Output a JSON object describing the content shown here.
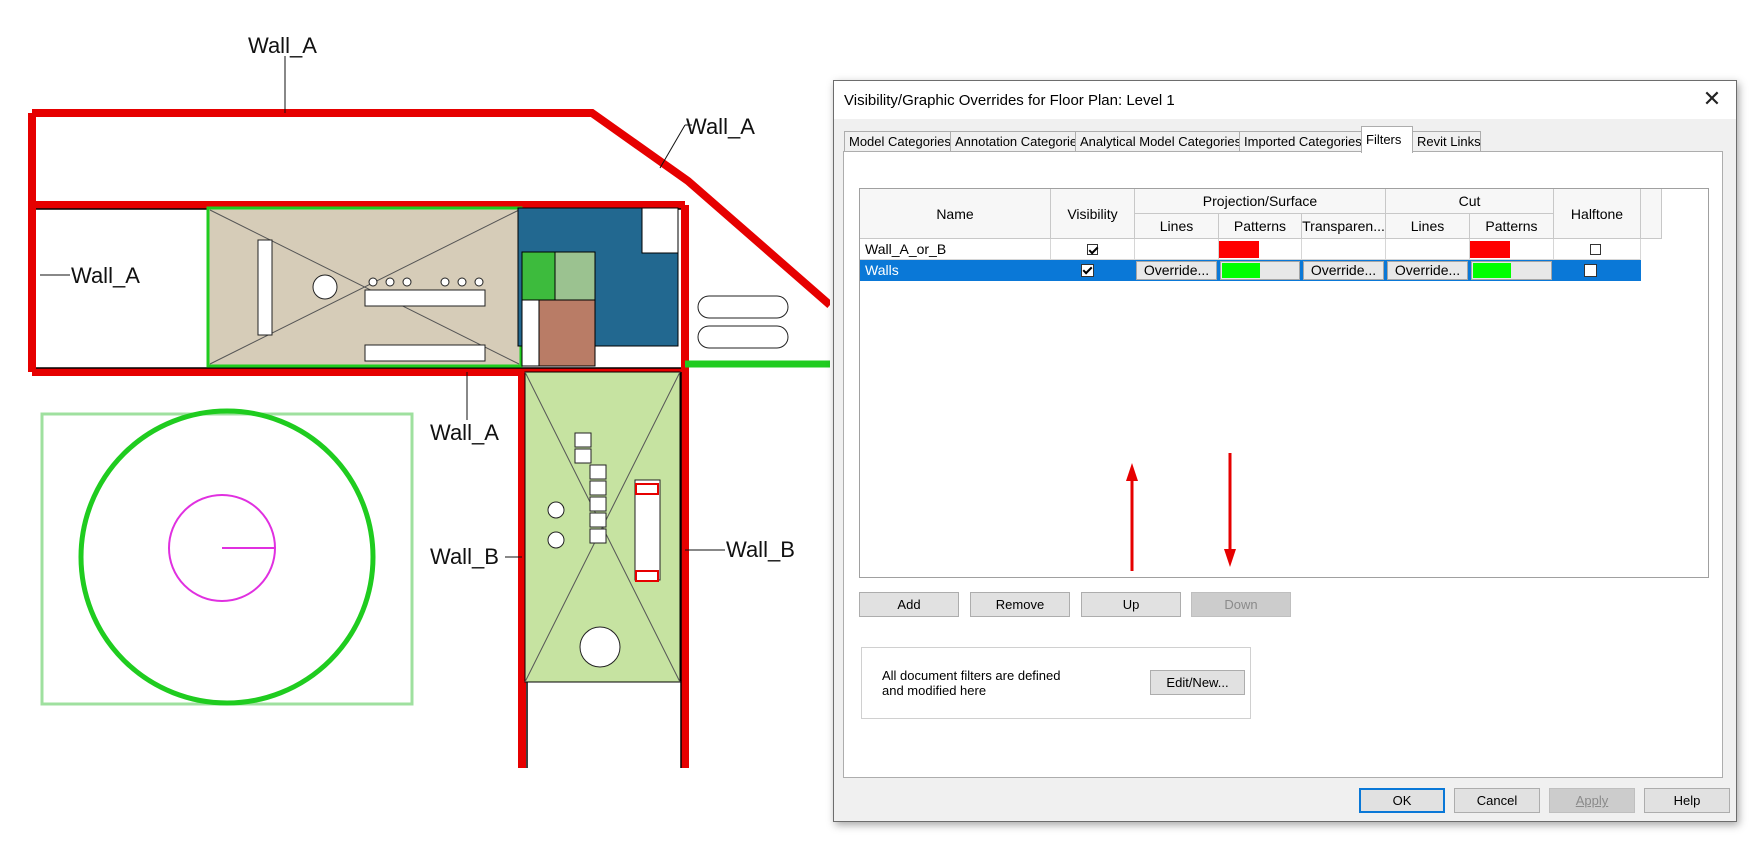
{
  "plan": {
    "labels": {
      "wall_a_top": "Wall_A",
      "wall_a_diag": "Wall_A",
      "wall_a_left": "Wall_A",
      "wall_a_bottom": "Wall_A",
      "wall_b_left": "Wall_B",
      "wall_b_right": "Wall_B"
    },
    "colors": {
      "wall_a": "#e60000",
      "wall_b_line": "#1fcc1f",
      "room_beige": "#d6ccb8",
      "room_blue": "#226890",
      "room_green": "#c6e3a1",
      "room_brown": "#b97c66",
      "circle_magenta": "#e030e0"
    }
  },
  "dialog": {
    "title": "Visibility/Graphic Overrides for Floor Plan: Level 1",
    "close_glyph": "✕",
    "tabs": [
      {
        "label": "Model Categories"
      },
      {
        "label": "Annotation Categories"
      },
      {
        "label": "Analytical Model Categories"
      },
      {
        "label": "Imported Categories"
      },
      {
        "label": "Filters"
      },
      {
        "label": "Revit Links"
      }
    ],
    "active_tab": "Filters",
    "grid": {
      "headers": {
        "name": "Name",
        "visibility": "Visibility",
        "projection_surface": "Projection/Surface",
        "cut": "Cut",
        "halftone": "Halftone",
        "proj_lines": "Lines",
        "proj_patterns": "Patterns",
        "proj_transparency": "Transparen...",
        "cut_lines": "Lines",
        "cut_patterns": "Patterns"
      },
      "rows": [
        {
          "name": "Wall_A_or_B",
          "visible": true,
          "proj_pattern_color": "#ff0000",
          "cut_pattern_color": "#ff0000",
          "halftone": false,
          "selected": false
        },
        {
          "name": "Walls",
          "visible": true,
          "proj_lines": "Override...",
          "proj_pattern_color": "#00ff00",
          "proj_transparency": "Override...",
          "cut_lines": "Override...",
          "cut_pattern_color": "#00ff00",
          "halftone": false,
          "selected": true
        }
      ]
    },
    "buttons": {
      "add": "Add",
      "remove": "Remove",
      "up": "Up",
      "down": "Down",
      "edit_new": "Edit/New...",
      "ok": "OK",
      "cancel": "Cancel",
      "apply": "Apply",
      "help": "Help"
    },
    "info_text": "All document filters are defined and modified here",
    "arrow_color": "#e60000"
  }
}
